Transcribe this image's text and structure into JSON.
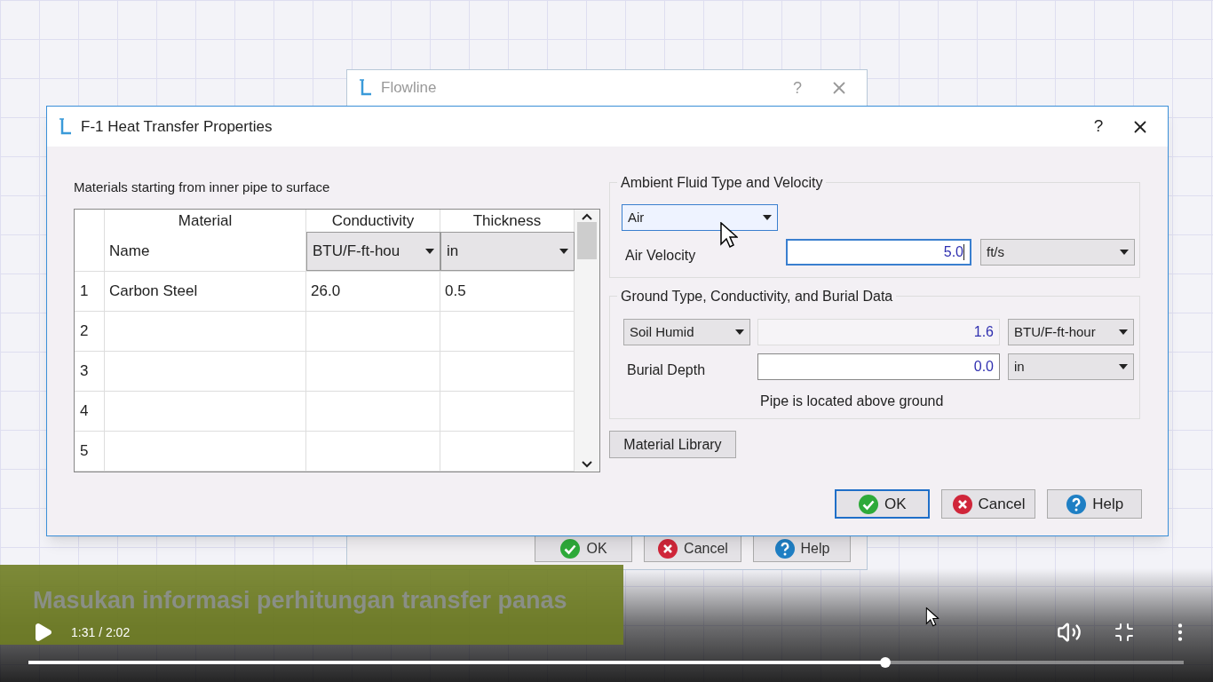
{
  "back_window": {
    "title": "Flowline",
    "help": "?",
    "buttons": [
      {
        "label": "OK",
        "kind": "ok"
      },
      {
        "label": "Cancel",
        "kind": "cancel"
      },
      {
        "label": "Help",
        "kind": "help"
      }
    ]
  },
  "dialog": {
    "title": "F-1 Heat Transfer Properties",
    "help": "?",
    "materials": {
      "label": "Materials starting from inner pipe to surface",
      "columns": [
        "Material",
        "Conductivity",
        "Thickness"
      ],
      "name_label": "Name",
      "conductivity_unit": "BTU/F-ft-hou",
      "thickness_unit": "in",
      "rows": [
        {
          "index": "1",
          "name": "Carbon Steel",
          "conductivity": "26.0",
          "thickness": "0.5"
        },
        {
          "index": "2"
        },
        {
          "index": "3"
        },
        {
          "index": "4"
        },
        {
          "index": "5"
        }
      ]
    },
    "ambient": {
      "legend": "Ambient Fluid Type and Velocity",
      "fluid": "Air",
      "velocity_label": "Air Velocity",
      "velocity": "5.0",
      "velocity_unit": "ft/s"
    },
    "ground": {
      "legend": "Ground Type, Conductivity, and Burial Data",
      "type": "Soil Humid",
      "conductivity": "1.6",
      "conductivity_unit": "BTU/F-ft-hour",
      "depth_label": "Burial Depth",
      "depth": "0.0",
      "depth_unit": "in",
      "note": "Pipe is located above ground"
    },
    "material_library": "Material Library",
    "buttons": [
      {
        "label": "OK",
        "kind": "ok",
        "focused": true
      },
      {
        "label": "Cancel",
        "kind": "cancel",
        "focused": false
      },
      {
        "label": "Help",
        "kind": "help",
        "focused": false
      }
    ]
  },
  "player": {
    "caption": "Masukan informasi perhitungan transfer panas",
    "time": "1:31 / 2:02",
    "progress": {
      "level": 0.742
    }
  }
}
